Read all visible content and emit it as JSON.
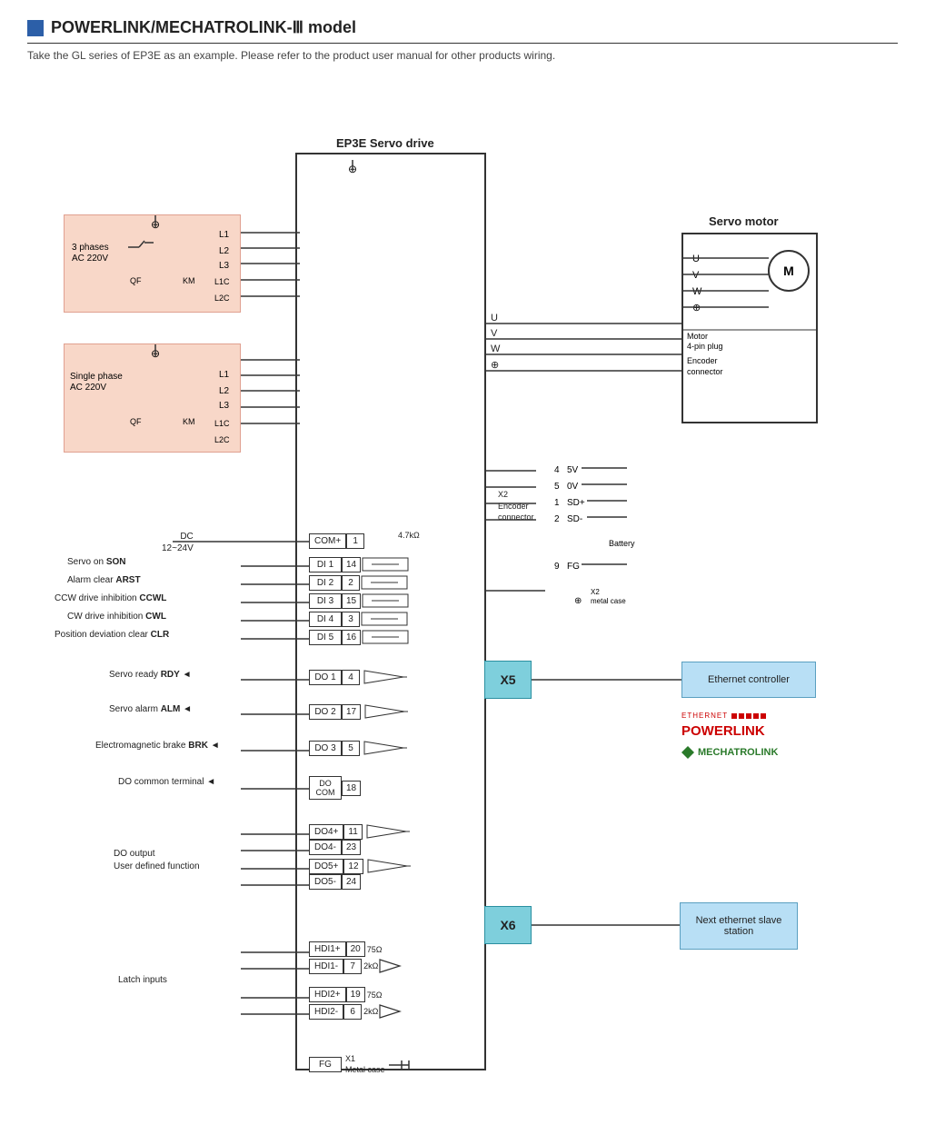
{
  "title": "POWERLINK/MECHATROLINK-Ⅲ model",
  "subtitle": "Take the GL series of EP3E as an example. Please refer to the product user manual for other products wiring.",
  "servo_drive_label": "EP3E Servo drive",
  "servo_motor_label": "Servo motor",
  "motor_label": "M",
  "motor_plug_label": "Motor\n4-pin plug",
  "encoder_connector_label": "Encoder\nconnector",
  "power_3phase": {
    "label1": "3 phases",
    "label2": "AC 220V",
    "qf": "QF",
    "km": "KM"
  },
  "power_single": {
    "label1": "Single phase",
    "label2": "AC 220V",
    "qf": "QF",
    "km": "KM"
  },
  "dc_label": "DC\n12~24V",
  "terminals_di": [
    {
      "name": "COM+",
      "num": "1"
    },
    {
      "name": "DI 1",
      "num": "14"
    },
    {
      "name": "DI 2",
      "num": "2"
    },
    {
      "name": "DI 3",
      "num": "15"
    },
    {
      "name": "DI 4",
      "num": "3"
    },
    {
      "name": "DI 5",
      "num": "16"
    }
  ],
  "terminals_do": [
    {
      "name": "DO 1",
      "num": "4"
    },
    {
      "name": "DO 2",
      "num": "17"
    },
    {
      "name": "DO 3",
      "num": "5"
    },
    {
      "name": "DO COM",
      "num": "18"
    },
    {
      "name": "DO4+",
      "num": "11"
    },
    {
      "name": "DO4-",
      "num": "23"
    },
    {
      "name": "DO5+",
      "num": "12"
    },
    {
      "name": "DO5-",
      "num": "24"
    }
  ],
  "di_signals": [
    {
      "sig": "Servo on",
      "abbr": "SON"
    },
    {
      "sig": "Alarm clear",
      "abbr": "ARST"
    },
    {
      "sig": "CCW drive inhibition",
      "abbr": "CCWL"
    },
    {
      "sig": "CW drive inhibition",
      "abbr": "CWL"
    },
    {
      "sig": "Position deviation clear",
      "abbr": "CLR"
    }
  ],
  "do_signals": [
    {
      "sig": "Servo ready",
      "abbr": "RDY"
    },
    {
      "sig": "Servo alarm",
      "abbr": "ALM"
    },
    {
      "sig": "Electromagnetic brake",
      "abbr": "BRK"
    },
    {
      "sig": "DO common terminal",
      "abbr": ""
    }
  ],
  "do_output_label": "DO output\nUser defined function",
  "latch_label": "Latch inputs",
  "latch_terminals": [
    {
      "name": "HDI1+",
      "num": "20",
      "r1": "75Ω",
      "r2": "2kΩ"
    },
    {
      "name": "HDI1-",
      "num": "7"
    },
    {
      "name": "HDI2+",
      "num": "19",
      "r1": "75Ω",
      "r2": "2kΩ"
    },
    {
      "name": "HDI2-",
      "num": "6"
    }
  ],
  "fg_terminal": {
    "name": "FG",
    "sub": "X1\nMetal case"
  },
  "encoder_pins": [
    {
      "num": "4",
      "sig": "5V"
    },
    {
      "num": "5",
      "sig": "0V"
    },
    {
      "num": "1",
      "sig": "SD+"
    },
    {
      "num": "2",
      "sig": "SD-"
    }
  ],
  "fg_pin": {
    "num": "9",
    "sig": "FG"
  },
  "battery_label": "Battery",
  "x2_label": "X2\nEncoder\nconnector",
  "x2_metal_label": "X2\nmetal case",
  "resistor_4k7": "4.7kΩ",
  "x5_label": "X5",
  "x6_label": "X6",
  "eth_controller_label": "Ethernet controller",
  "next_eth_label": "Next ethernet\nslave station",
  "powerlink_label": "POWERLINK",
  "powerlink_prefix": "ETHERNET",
  "mechatrolink_label": "MECHATROLINK",
  "uvw_labels": [
    "U",
    "V",
    "W"
  ],
  "motor_uvw": [
    "U",
    "V",
    "W"
  ],
  "ground_sym": "⊕"
}
